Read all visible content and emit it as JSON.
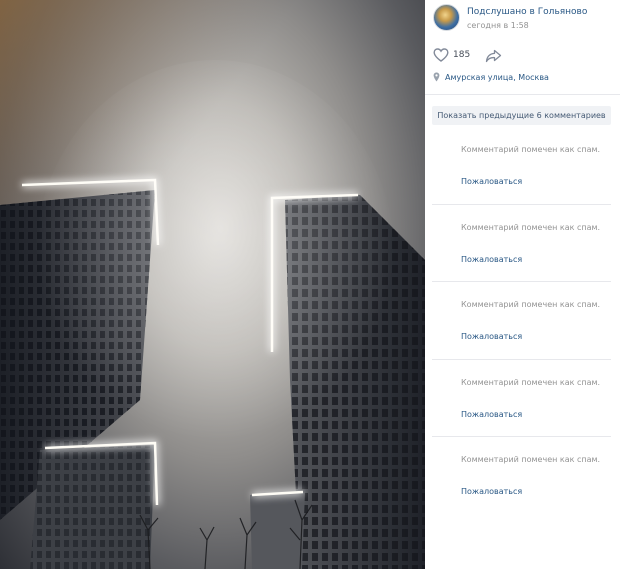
{
  "post": {
    "group_name": "Подслушано в Гольяново",
    "date": "сегодня в 1:58",
    "likes": "185",
    "location": "Амурская улица, Москва"
  },
  "comments_section": {
    "show_previous_label": "Показать предыдущие 6 комментариев",
    "items": [
      {
        "text": "Комментарий помечен как спам.",
        "report_label": "Пожаловаться"
      },
      {
        "text": "Комментарий помечен как спам.",
        "report_label": "Пожаловаться"
      },
      {
        "text": "Комментарий помечен как спам.",
        "report_label": "Пожаловаться"
      },
      {
        "text": "Комментарий помечен как спам.",
        "report_label": "Пожаловаться"
      },
      {
        "text": "Комментарий помечен как спам.",
        "report_label": "Пожаловаться"
      }
    ]
  },
  "icons": {
    "like": "heart-icon",
    "share": "share-arrow-icon",
    "location": "map-pin-icon"
  },
  "colors": {
    "link": "#2a5885",
    "muted": "#939393",
    "button_bg": "#f0f2f5"
  }
}
